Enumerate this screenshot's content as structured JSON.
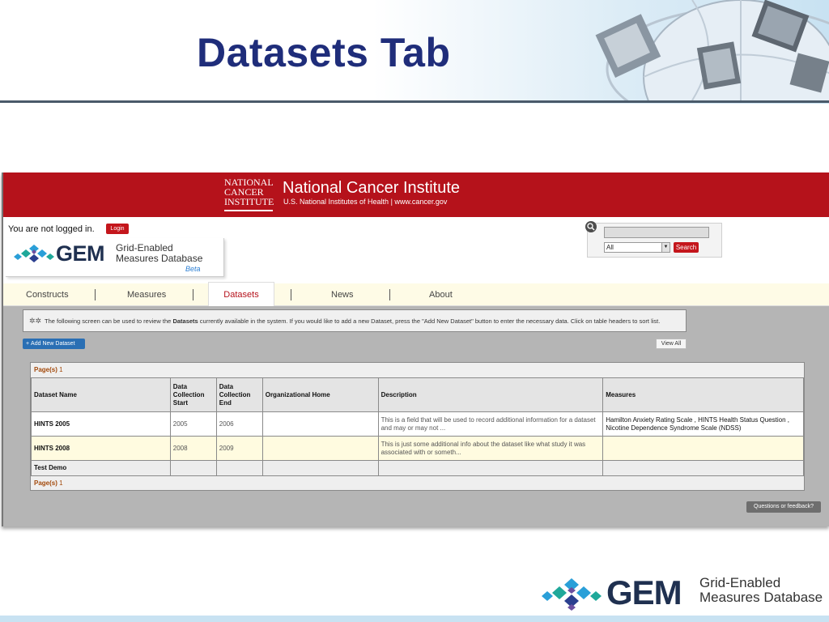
{
  "slide": {
    "title": "Datasets Tab"
  },
  "nci": {
    "logo_lines": [
      "NATIONAL",
      "CANCER",
      "INSTITUTE"
    ],
    "title": "National Cancer Institute",
    "subtitle": "U.S. National Institutes of Health  |  www.cancer.gov"
  },
  "auth": {
    "status": "You are not logged in.",
    "login_label": "Login"
  },
  "gem": {
    "name": "GEM",
    "line1": "Grid-Enabled",
    "line2": "Measures Database",
    "beta": "Beta"
  },
  "search": {
    "value": "",
    "scope_selected": "All",
    "button_label": "Search"
  },
  "tabs": [
    {
      "label": "Constructs"
    },
    {
      "label": "Measures"
    },
    {
      "label": "Datasets"
    },
    {
      "label": "News"
    },
    {
      "label": "About"
    }
  ],
  "active_tab": "Datasets",
  "info": {
    "text_before": "The following screen can be used to review the ",
    "text_bold": "Datasets",
    "text_after": " currently available in the system. If you would like to add a new Dataset, press the \"Add New Dataset\" button to enter the necessary data. Click on table headers to sort list."
  },
  "actions": {
    "add_label": "Add New Dataset",
    "view_all_label": "View All"
  },
  "pager": {
    "label": "Page(s)",
    "page": "1"
  },
  "table": {
    "headers": [
      "Dataset Name",
      "Data Collection Start",
      "Data Collection End",
      "Organizational Home",
      "Description",
      "Measures"
    ],
    "rows": [
      {
        "name": "HINTS 2005",
        "start": "2005",
        "end": "2006",
        "org": "",
        "description": "This is a field that will be used to record additional information for a dataset and may or may not ...",
        "measures": "Hamilton Anxiety Rating Scale , HINTS Health Status Question , Nicotine Dependence Syndrome Scale (NDSS)"
      },
      {
        "name": "HINTS 2008",
        "start": "2008",
        "end": "2009",
        "org": "",
        "description": "This is just some additional info about the dataset like what study it was associated with or someth...",
        "measures": ""
      },
      {
        "name": "Test Demo",
        "start": "",
        "end": "",
        "org": "",
        "description": "",
        "measures": ""
      }
    ]
  },
  "feedback": {
    "label": "Questions or feedback?"
  },
  "footer_logo": {
    "name": "GEM",
    "line1": "Grid-Enabled",
    "line2": "Measures Database"
  },
  "colors": {
    "nci_red": "#b5121b",
    "title_blue": "#1f2d7a",
    "gem_navy": "#1f3050",
    "tab_bar": "#fefbe6"
  }
}
